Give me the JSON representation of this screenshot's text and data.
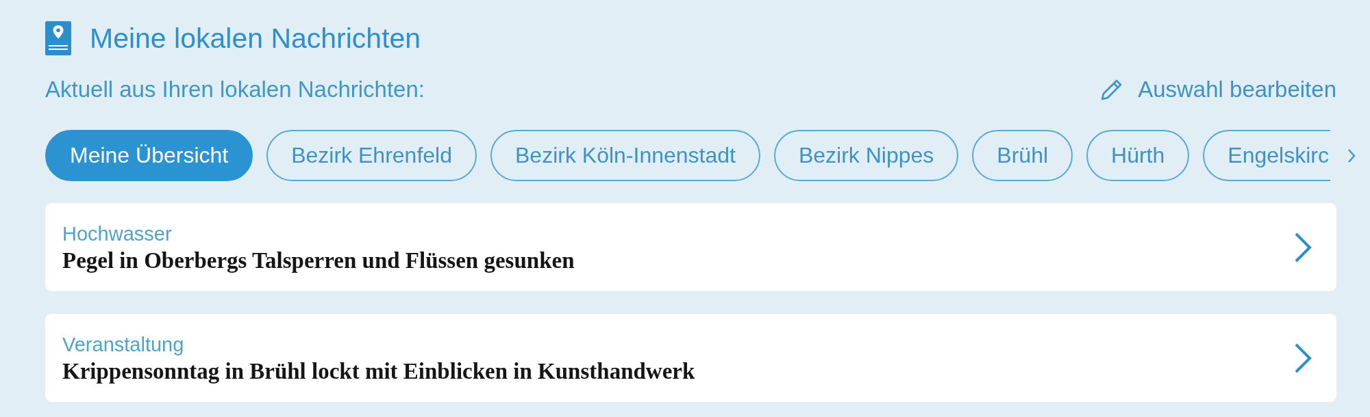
{
  "header": {
    "title": "Meine lokalen Nachrichten"
  },
  "subheader": {
    "text": "Aktuell aus Ihren lokalen Nachrichten:",
    "edit_link": "Auswahl bearbeiten"
  },
  "tabs": [
    {
      "label": "Meine Übersicht",
      "selected": true
    },
    {
      "label": "Bezirk Ehrenfeld",
      "selected": false
    },
    {
      "label": "Bezirk Köln-Innenstadt",
      "selected": false
    },
    {
      "label": "Bezirk Nippes",
      "selected": false
    },
    {
      "label": "Brühl",
      "selected": false
    },
    {
      "label": "Hürth",
      "selected": false
    },
    {
      "label": "Engelskirc",
      "selected": false
    }
  ],
  "articles": [
    {
      "category": "Hochwasser",
      "headline": "Pegel in Oberbergs Talsperren und Flüssen gesunken"
    },
    {
      "category": "Veranstaltung",
      "headline": "Krippensonntag in Brühl lockt mit Einblicken in Kunsthandwerk"
    }
  ]
}
